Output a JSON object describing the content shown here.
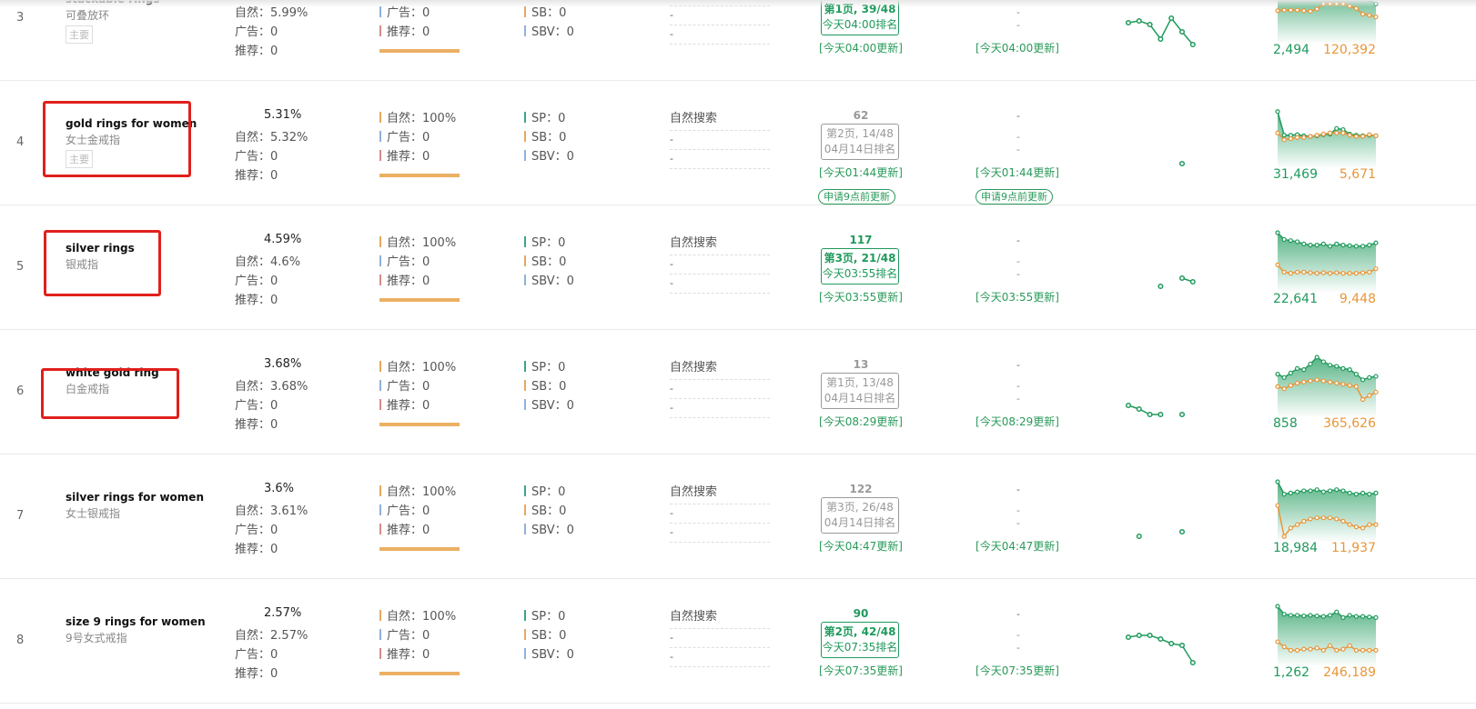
{
  "labels": {
    "organic": "自然：",
    "ads": "广告：",
    "recommend": "推荐：",
    "sp": "SP：",
    "sb": "SB：",
    "sbv": "SBV：",
    "search_type": "自然搜索",
    "apply": "申请9点前更新",
    "dash": "-"
  },
  "colors": {
    "green": "#1f9a5c",
    "orange": "#e8963a",
    "gray_rank": "#999999",
    "organic_bar": "#e8a860",
    "ads_bar": "#8fb0dd",
    "recommend_bar": "#d88a8a",
    "sp_bar": "#3aa58a",
    "highlight_box": "#e0201c"
  },
  "rows": [
    {
      "index": "3",
      "keyword": "stackable rings",
      "keyword_cn": "可叠放环",
      "tag": "主要",
      "total": "",
      "organic": "5.99%",
      "ads": "0",
      "recommend": "0",
      "bar_organic": "100%",
      "bar_ads": "0",
      "bar_recommend": "0",
      "sp": "0",
      "sb": "0",
      "sbv": "0",
      "search_type": "",
      "rank": "",
      "rank_page": "第1页, 39/48",
      "rank_time": "今天04:00排名",
      "rank_current": true,
      "update1": "[今天04:00更新]",
      "update2": "[今天04:00更新]",
      "apply": false,
      "highlighted": false,
      "trend": [
        6.75,
        7.25,
        6.25,
        2.25,
        8,
        4.25,
        0.75
      ],
      "area_green": [
        80,
        80,
        80,
        80,
        80,
        80,
        80,
        82,
        84,
        86,
        86,
        84,
        82,
        78,
        72,
        64
      ],
      "area_orange": [
        52,
        53,
        53,
        53,
        52,
        51,
        55,
        64,
        64,
        64,
        64,
        60,
        56,
        46,
        44,
        41
      ],
      "value_green": "2,494",
      "value_orange": "120,392"
    },
    {
      "index": "4",
      "keyword": "gold rings for women",
      "keyword_cn": "女士金戒指",
      "tag": "主要",
      "total": "5.31%",
      "organic": "5.32%",
      "ads": "0",
      "recommend": "0",
      "bar_organic": "100%",
      "bar_ads": "0",
      "bar_recommend": "0",
      "sp": "0",
      "sb": "0",
      "sbv": "0",
      "search_type": "自然搜索",
      "rank": "62",
      "rank_page": "第2页, 14/48",
      "rank_time": "04月14日排名",
      "rank_current": false,
      "update1": "[今天01:44更新]",
      "update2": "[今天01:44更新]",
      "apply": true,
      "highlighted": true,
      "trend": [
        null,
        null,
        null,
        null,
        null,
        2.25,
        null
      ],
      "area_green": [
        94,
        52,
        52,
        53,
        51,
        50,
        51,
        53,
        54,
        64,
        62,
        54,
        52,
        51,
        52,
        51
      ],
      "area_orange": [
        56,
        44,
        46,
        48,
        48,
        50,
        52,
        54,
        56,
        56,
        56,
        52,
        50,
        50,
        53,
        51
      ],
      "value_green": "31,469",
      "value_orange": "5,671"
    },
    {
      "index": "5",
      "keyword": "silver rings",
      "keyword_cn": "银戒指",
      "tag": "",
      "total": "4.59%",
      "organic": "4.6%",
      "ads": "0",
      "recommend": "0",
      "bar_organic": "100%",
      "bar_ads": "0",
      "bar_recommend": "0",
      "sp": "0",
      "sb": "0",
      "sbv": "0",
      "search_type": "自然搜索",
      "rank": "117",
      "rank_page": "第3页, 21/48",
      "rank_time": "今天03:55排名",
      "rank_current": true,
      "update1": "[今天03:55更新]",
      "update2": "[今天03:55更新]",
      "apply": false,
      "highlighted": true,
      "trend": [
        null,
        null,
        null,
        2.75,
        null,
        5,
        4
      ],
      "area_green": [
        100,
        88,
        86,
        84,
        80,
        78,
        78,
        80,
        76,
        80,
        78,
        77,
        76,
        76,
        78,
        82
      ],
      "area_orange": [
        43,
        30,
        28,
        30,
        30,
        29,
        28,
        29,
        28,
        29,
        28,
        28,
        28,
        29,
        30,
        36
      ],
      "value_green": "22,641",
      "value_orange": "9,448"
    },
    {
      "index": "6",
      "keyword": "white gold ring",
      "keyword_cn": "白金戒指",
      "tag": "",
      "total": "3.68%",
      "organic": "3.68%",
      "ads": "0",
      "recommend": "0",
      "bar_organic": "100%",
      "bar_ads": "0",
      "bar_recommend": "0",
      "sp": "0",
      "sb": "0",
      "sbv": "0",
      "search_type": "自然搜索",
      "rank": "13",
      "rank_page": "第1页, 13/48",
      "rank_time": "04月14日排名",
      "rank_current": false,
      "update1": "[今天08:29更新]",
      "update2": "[今天08:29更新]",
      "apply": false,
      "highlighted": true,
      "trend": [
        4.25,
        3.25,
        1.75,
        1.75,
        null,
        1.75,
        null
      ],
      "area_green": [
        70,
        64,
        72,
        80,
        78,
        88,
        100,
        92,
        86,
        84,
        80,
        78,
        70,
        60,
        64,
        66
      ],
      "area_orange": [
        48,
        44,
        50,
        54,
        56,
        58,
        60,
        58,
        56,
        54,
        52,
        50,
        48,
        25,
        32,
        38
      ],
      "value_green": "858",
      "value_orange": "365,626"
    },
    {
      "index": "7",
      "keyword": "silver rings for women",
      "keyword_cn": "女士银戒指",
      "tag": "",
      "total": "3.6%",
      "organic": "3.61%",
      "ads": "0",
      "recommend": "0",
      "bar_organic": "100%",
      "bar_ads": "0",
      "bar_recommend": "0",
      "sp": "0",
      "sb": "0",
      "sbv": "0",
      "search_type": "自然搜索",
      "rank": "122",
      "rank_page": "第3页, 26/48",
      "rank_time": "04月14日排名",
      "rank_current": false,
      "update1": "[今天04:47更新]",
      "update2": "[今天04:47更新]",
      "apply": false,
      "highlighted": false,
      "trend": [
        null,
        2.5,
        null,
        null,
        null,
        3.75,
        null
      ],
      "area_green": [
        100,
        78,
        80,
        82,
        84,
        84,
        86,
        82,
        84,
        86,
        84,
        80,
        78,
        80,
        78,
        80
      ],
      "area_orange": [
        58,
        3,
        18,
        24,
        30,
        34,
        36,
        36,
        36,
        34,
        30,
        24,
        20,
        18,
        24,
        24
      ],
      "value_green": "18,984",
      "value_orange": "11,937"
    },
    {
      "index": "8",
      "keyword": "size 9 rings for women",
      "keyword_cn": "9号女式戒指",
      "tag": "",
      "total": "2.57%",
      "organic": "2.57%",
      "ads": "0",
      "recommend": "0",
      "bar_organic": "100%",
      "bar_ads": "0",
      "bar_recommend": "0",
      "sp": "0",
      "sb": "0",
      "sbv": "0",
      "search_type": "自然搜索",
      "rank": "90",
      "rank_page": "第2页, 42/48",
      "rank_time": "今天07:35排名",
      "rank_current": true,
      "update1": "[今天07:35更新]",
      "update2": "[今天07:35更新]",
      "apply": false,
      "highlighted": false,
      "trend": [
        9,
        9.5,
        9.5,
        8.5,
        7.25,
        6.75,
        2
      ],
      "area_green": [
        100,
        86,
        84,
        84,
        83,
        84,
        83,
        82,
        84,
        90,
        80,
        84,
        82,
        82,
        81,
        80
      ],
      "area_orange": [
        37,
        28,
        22,
        22,
        24,
        24,
        26,
        22,
        30,
        22,
        24,
        30,
        22,
        22,
        22,
        22
      ],
      "value_green": "1,262",
      "value_orange": "246,189"
    }
  ]
}
